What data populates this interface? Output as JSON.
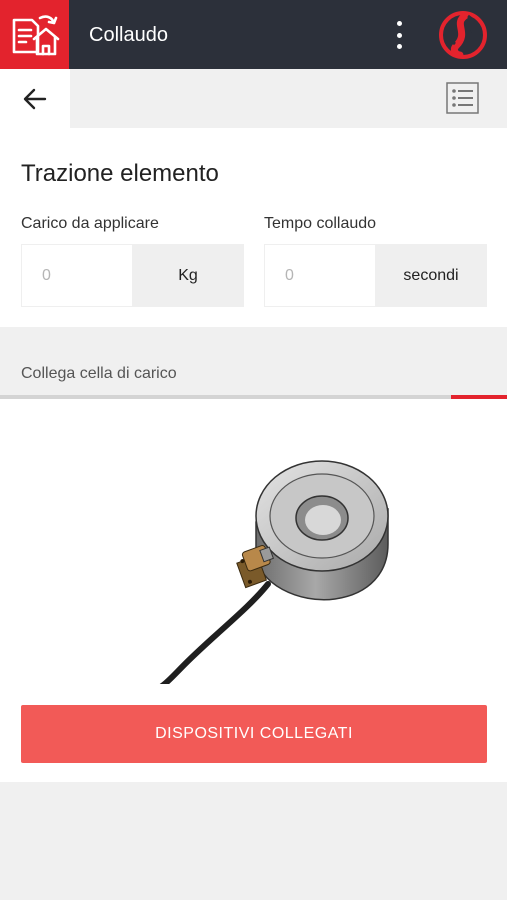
{
  "header": {
    "title": "Collaudo",
    "home_icon": "document-home-icon",
    "menu_icon": "kebab-menu-icon",
    "logo_icon": "brand-logo-icon",
    "accent_color": "#e3232d",
    "bar_color": "#2c303a"
  },
  "subbar": {
    "back_icon": "arrow-left-icon",
    "list_icon": "list-icon"
  },
  "form": {
    "title": "Trazione elemento",
    "load": {
      "label": "Carico da applicare",
      "placeholder": "0",
      "value": "",
      "unit": "Kg"
    },
    "time": {
      "label": "Tempo collaudo",
      "placeholder": "0",
      "value": "",
      "unit": "secondi"
    }
  },
  "step": {
    "label": "Collega cella di carico",
    "progress_fraction": 0.11
  },
  "device": {
    "image_name": "load-cell-image"
  },
  "action": {
    "label": "DISPOSITIVI COLLEGATI",
    "color": "#f25a57"
  }
}
